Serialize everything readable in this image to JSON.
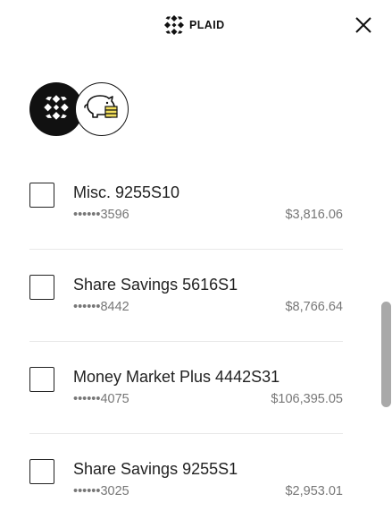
{
  "header": {
    "brand_name": "PLAID",
    "brand_icon": "plaid-logo-icon",
    "close_icon": "close-icon"
  },
  "logos": {
    "primary_icon": "plaid-logo-icon",
    "secondary_icon": "piggy-bank-icon"
  },
  "accounts": [
    {
      "name": "Misc. 9255S10",
      "mask": "••••••3596",
      "balance": "$3,816.06",
      "checked": false
    },
    {
      "name": "Share Savings 5616S1",
      "mask": "••••••8442",
      "balance": "$8,766.64",
      "checked": false
    },
    {
      "name": "Money Market Plus 4442S31",
      "mask": "••••••4075",
      "balance": "$106,395.05",
      "checked": false
    },
    {
      "name": "Share Savings 9255S1",
      "mask": "••••••3025",
      "balance": "$2,953.01",
      "checked": false
    }
  ],
  "colors": {
    "text_primary": "#222222",
    "text_secondary": "#777777",
    "brand_dark": "#111111",
    "piggy_accent": "#f2df5c",
    "divider": "#e8e8e8",
    "scrollbar": "#a9a9a9"
  }
}
